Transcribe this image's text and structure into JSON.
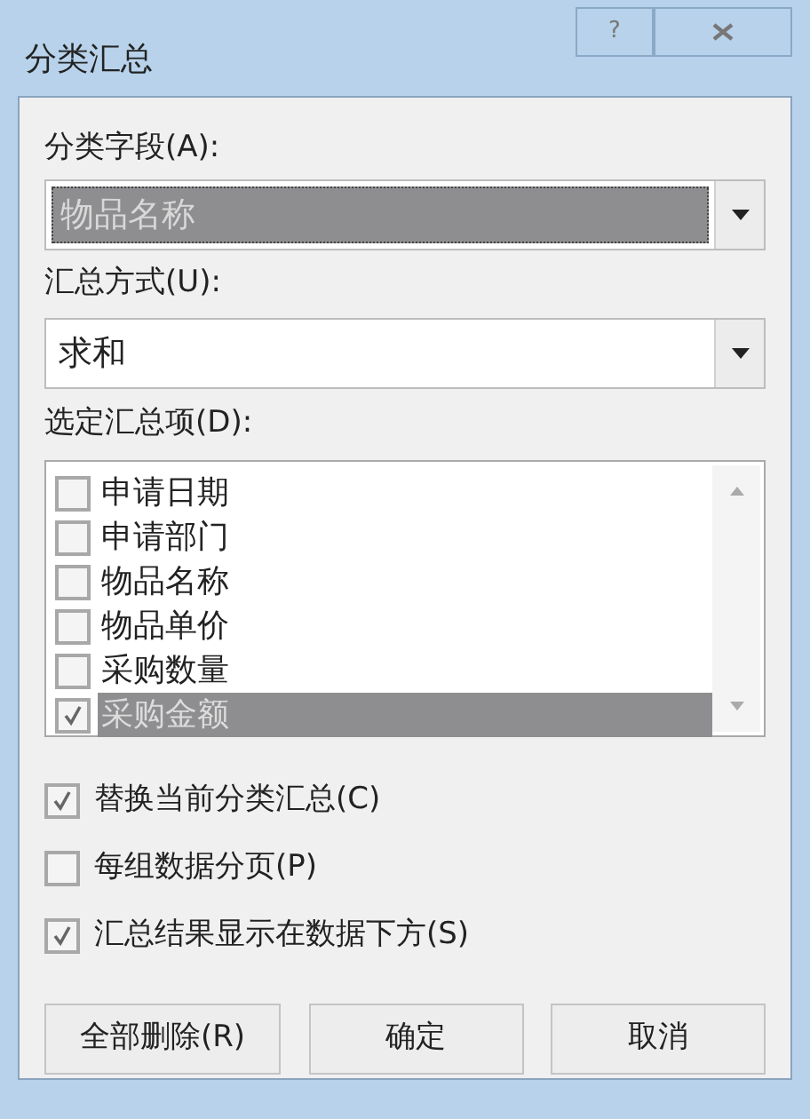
{
  "window": {
    "title": "分类汇总",
    "help_button": "?"
  },
  "group_by": {
    "label": "分类字段(A):",
    "value": "物品名称",
    "focused": true
  },
  "function": {
    "label": "汇总方式(U):",
    "value": "求和",
    "focused": false
  },
  "subtotal_fields": {
    "label": "选定汇总项(D):",
    "items": [
      {
        "label": "申请日期",
        "checked": false,
        "selected": false
      },
      {
        "label": "申请部门",
        "checked": false,
        "selected": false
      },
      {
        "label": "物品名称",
        "checked": false,
        "selected": false
      },
      {
        "label": "物品单价",
        "checked": false,
        "selected": false
      },
      {
        "label": "采购数量",
        "checked": false,
        "selected": false
      },
      {
        "label": "采购金额",
        "checked": true,
        "selected": true
      }
    ]
  },
  "options": [
    {
      "label": "替换当前分类汇总(C)",
      "checked": true
    },
    {
      "label": "每组数据分页(P)",
      "checked": false
    },
    {
      "label": "汇总结果显示在数据下方(S)",
      "checked": true
    }
  ],
  "buttons": [
    {
      "label": "全部删除(R)"
    },
    {
      "label": "确定"
    },
    {
      "label": "取消"
    }
  ]
}
